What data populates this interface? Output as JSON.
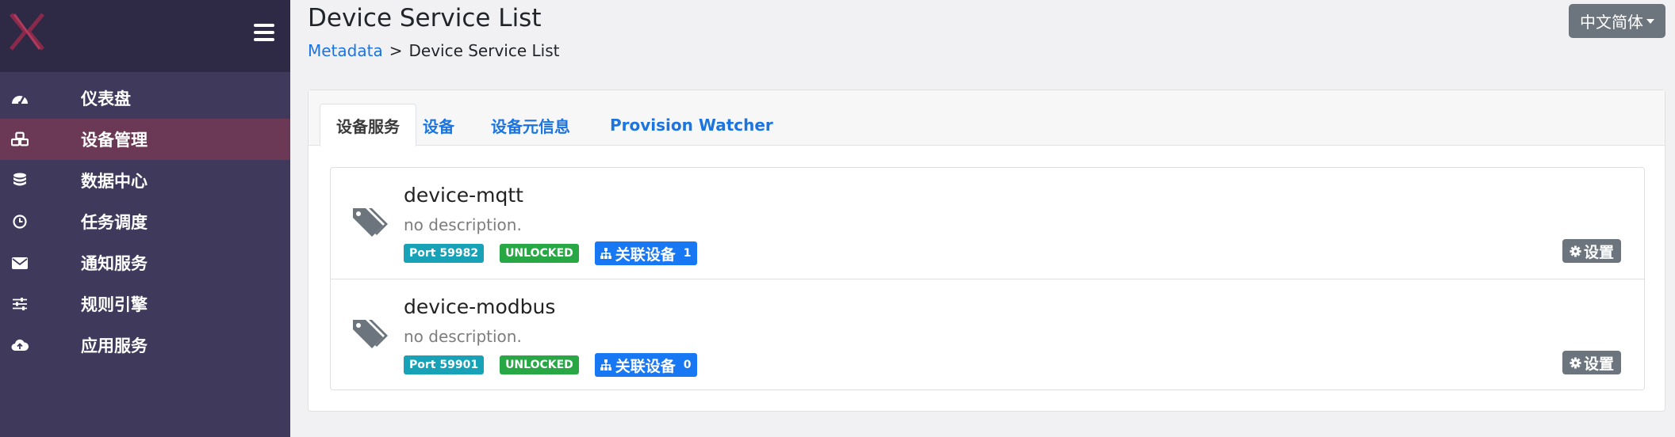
{
  "header": {
    "title": "Device Service List",
    "breadcrumb": {
      "parent": "Metadata",
      "separator": ">",
      "current": "Device Service List"
    },
    "language_button": "中文简体"
  },
  "sidebar": {
    "logo_icon": "x-logo-icon",
    "menu_icon": "hamburger-icon",
    "items": [
      {
        "label": "仪表盘",
        "icon": "dashboard-icon",
        "active": false
      },
      {
        "label": "设备管理",
        "icon": "cubes-icon",
        "active": true
      },
      {
        "label": "数据中心",
        "icon": "database-icon",
        "active": false
      },
      {
        "label": "任务调度",
        "icon": "clock-icon",
        "active": false
      },
      {
        "label": "通知服务",
        "icon": "envelope-icon",
        "active": false
      },
      {
        "label": "规则引擎",
        "icon": "sliders-icon",
        "active": false
      },
      {
        "label": "应用服务",
        "icon": "cloud-upload-icon",
        "active": false
      }
    ]
  },
  "tabs": [
    {
      "label": "设备服务",
      "active": true
    },
    {
      "label": "设备",
      "active": false
    },
    {
      "label": "设备元信息",
      "active": false
    },
    {
      "label": "Provision Watcher",
      "active": false
    }
  ],
  "services": [
    {
      "name": "device-mqtt",
      "description": "no description.",
      "port": "Port 59982",
      "state": "UNLOCKED",
      "associated_label": "关联设备",
      "associated_count": "1",
      "settings_label": "设置"
    },
    {
      "name": "device-modbus",
      "description": "no description.",
      "port": "Port 59901",
      "state": "UNLOCKED",
      "associated_label": "关联设备",
      "associated_count": "0",
      "settings_label": "设置"
    }
  ],
  "colors": {
    "sidebar": "#3f3a5c",
    "sidebar_header": "#2e2945",
    "active_item": "#6b3955",
    "link": "#1b74e0",
    "port_badge": "#17a2b8",
    "unlocked_badge": "#28a745",
    "assoc_badge": "#1877f2",
    "secondary": "#6c757d"
  }
}
